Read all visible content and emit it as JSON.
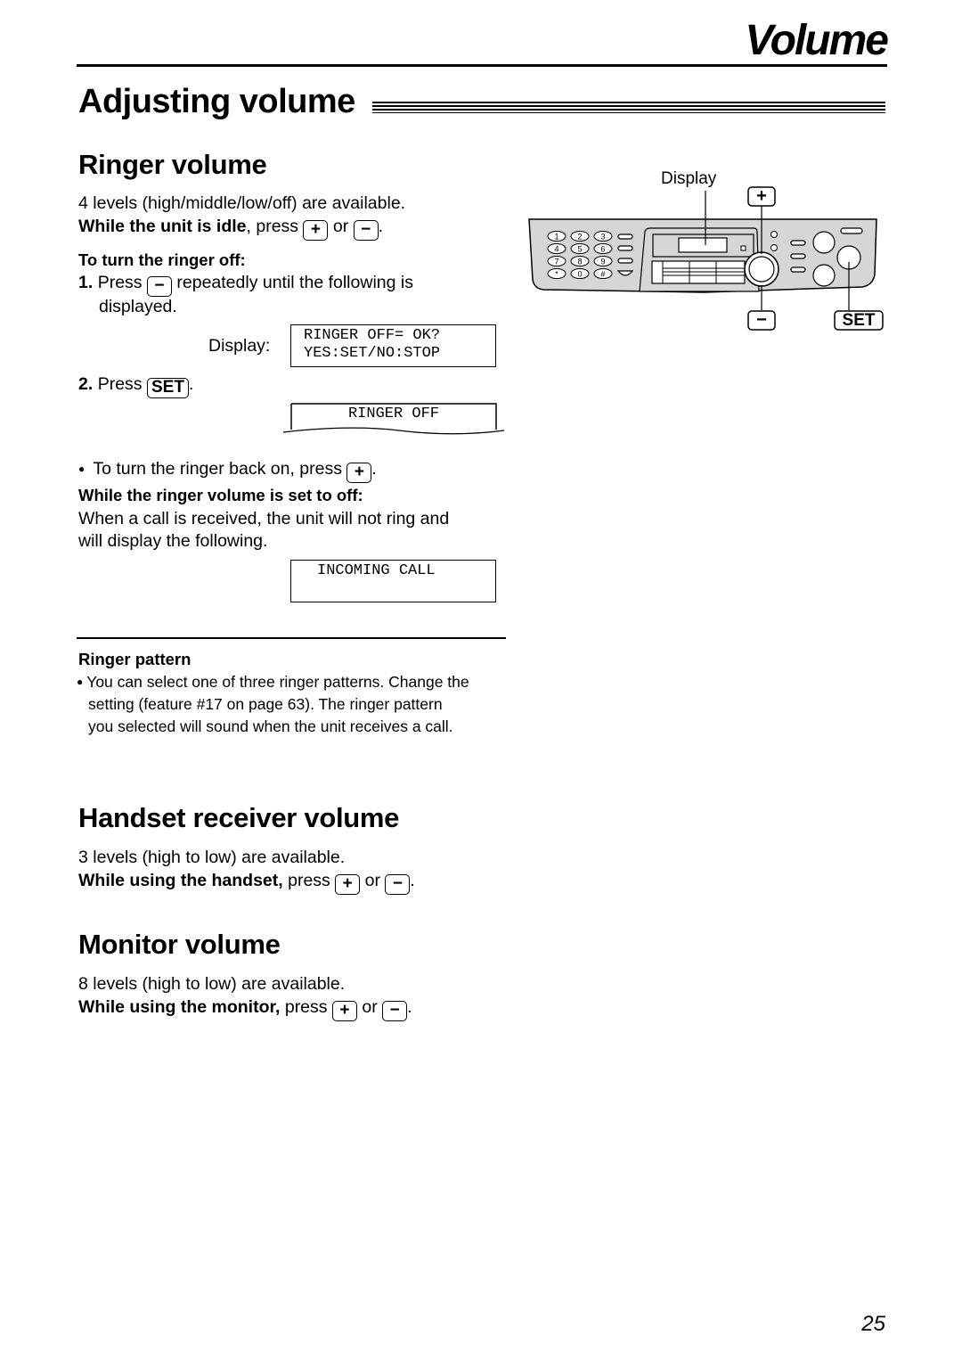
{
  "header": {
    "chapter_title": "Volume",
    "section_title": "Adjusting volume"
  },
  "ringer": {
    "title": "Ringer volume",
    "levels_text": "4 levels (high/middle/low/off) are available.",
    "idle_bold": "While the unit is idle",
    "idle_press": ", press",
    "or": "or",
    "period": ".",
    "turn_off_heading": "To turn the ringer off:",
    "step1_num": "1.",
    "step1_press": "Press",
    "step1_rest": "repeatedly until the following is",
    "step1_cont": "displayed.",
    "display_label": "Display:",
    "lcd1_line1": "RINGER OFF= OK?",
    "lcd1_line2": "YES:SET/NO:STOP",
    "step2_num": "2.",
    "step2_press": "Press",
    "lcd2": "RINGER OFF",
    "back_on_text": "To turn the ringer back on, press",
    "off_heading": "While the ringer volume is set to off:",
    "off_text_1": "When a call is received, the unit will not ring and",
    "off_text_2": "will display the following.",
    "lcd3": "INCOMING CALL"
  },
  "ringer_pattern": {
    "title": "Ringer pattern",
    "line1": "You can select one of three ringer patterns. Change the",
    "line2": "setting (feature #17 on page 63). The ringer pattern",
    "line3": "you selected will sound when the unit receives a call."
  },
  "handset": {
    "title": "Handset receiver volume",
    "levels_text": "3 levels (high to low) are available.",
    "bold": "While using the handset,",
    "press": "press",
    "or": "or"
  },
  "monitor": {
    "title": "Monitor volume",
    "levels_text": "8 levels (high to low) are available.",
    "bold": "While using the monitor,",
    "press": "press",
    "or": "or"
  },
  "keys": {
    "plus": "+",
    "minus": "−",
    "set": "SET"
  },
  "diagram": {
    "display_label": "Display",
    "plus_key": "+",
    "minus_key": "−",
    "set_key": "SET",
    "keypad": [
      "1",
      "2",
      "3",
      "4",
      "5",
      "6",
      "7",
      "8",
      "9",
      "*",
      "0",
      "#"
    ]
  },
  "footer": {
    "page_number": "25"
  }
}
